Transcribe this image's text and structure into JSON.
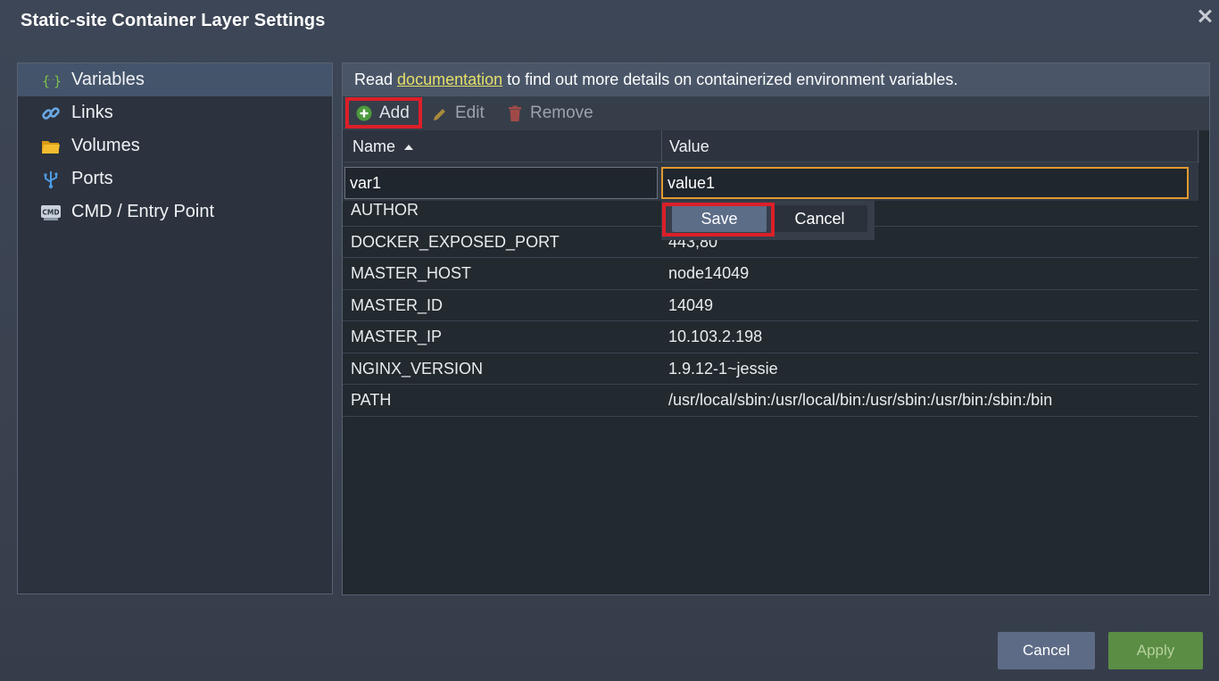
{
  "dialog": {
    "title": "Static-site Container Layer Settings"
  },
  "nav": {
    "items": [
      {
        "label": "Variables",
        "icon": "variables-icon",
        "active": true
      },
      {
        "label": "Links",
        "icon": "link-icon"
      },
      {
        "label": "Volumes",
        "icon": "folder-icon"
      },
      {
        "label": "Ports",
        "icon": "usb-port-icon"
      },
      {
        "label": "CMD / Entry Point",
        "icon": "cmd-icon"
      }
    ]
  },
  "info": {
    "prefix": "Read ",
    "link": "documentation",
    "suffix": " to find out more details on containerized environment variables."
  },
  "toolbar": {
    "add_label": "Add",
    "edit_label": "Edit",
    "remove_label": "Remove"
  },
  "grid": {
    "columns": {
      "name": "Name",
      "value": "Value",
      "sort": "ascending"
    },
    "editor": {
      "name_value": "var1",
      "value_value": "value1",
      "save_label": "Save",
      "cancel_label": "Cancel"
    },
    "rows": [
      {
        "name": "AUTHOR",
        "value": ""
      },
      {
        "name": "DOCKER_EXPOSED_PORT",
        "value": "443,80"
      },
      {
        "name": "MASTER_HOST",
        "value": "node14049"
      },
      {
        "name": "MASTER_ID",
        "value": "14049"
      },
      {
        "name": "MASTER_IP",
        "value": "10.103.2.198"
      },
      {
        "name": "NGINX_VERSION",
        "value": "1.9.12-1~jessie"
      },
      {
        "name": "PATH",
        "value": "/usr/local/sbin:/usr/local/bin:/usr/sbin:/usr/bin:/sbin:/bin"
      }
    ]
  },
  "footer": {
    "cancel_label": "Cancel",
    "apply_label": "Apply"
  },
  "colors": {
    "accent_highlight": "#dc1f28",
    "focus_border": "#e29a30",
    "apply_green": "#5b8d45",
    "link_yellow": "#e6e069"
  }
}
